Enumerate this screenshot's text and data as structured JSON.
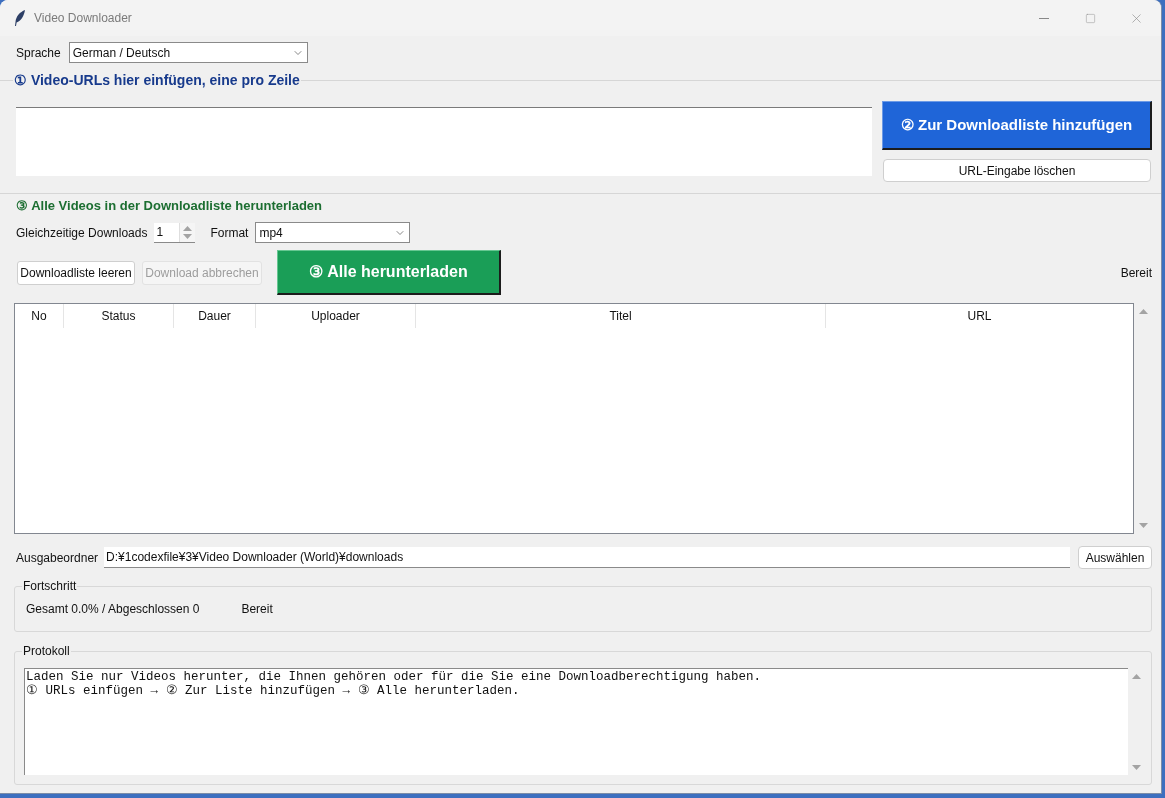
{
  "window": {
    "title": "Video Downloader"
  },
  "language": {
    "label": "Sprache",
    "value": "German / Deutsch"
  },
  "url_section": {
    "heading": "① Video-URLs hier einfügen, eine pro Zeile",
    "add_button": "② Zur Downloadliste hinzufügen",
    "clear_button": "URL-Eingabe löschen"
  },
  "download_section": {
    "heading": "③ Alle Videos in der Downloadliste herunterladen",
    "concurrent": {
      "label": "Gleichzeitige Downloads",
      "value": "1"
    },
    "format": {
      "label": "Format",
      "value": "mp4"
    },
    "buttons": [
      {
        "label": "Downloadliste leeren",
        "disabled": false
      },
      {
        "label": "Download abbrechen",
        "disabled": true
      }
    ],
    "start_button": "③ Alle herunterladen",
    "status": "Bereit"
  },
  "table": {
    "columns": [
      "No",
      "Status",
      "Dauer",
      "Uploader",
      "Titel",
      "URL"
    ]
  },
  "output_folder": {
    "label": "Ausgabeordner",
    "value": "D:¥1codexfile¥3¥Video Downloader (World)¥downloads",
    "button": "Auswählen"
  },
  "progress": {
    "title": "Fortschritt",
    "summary": "Gesamt 0.0% / Abgeschlossen 0",
    "status": "Bereit"
  },
  "log": {
    "title": "Protokoll",
    "lines": [
      "Laden Sie nur Videos herunter, die Ihnen gehören oder für die Sie eine Downloadberechtigung haben.",
      "① URLs einfügen → ② Zur Liste hinzufügen → ③ Alle herunterladen."
    ]
  }
}
